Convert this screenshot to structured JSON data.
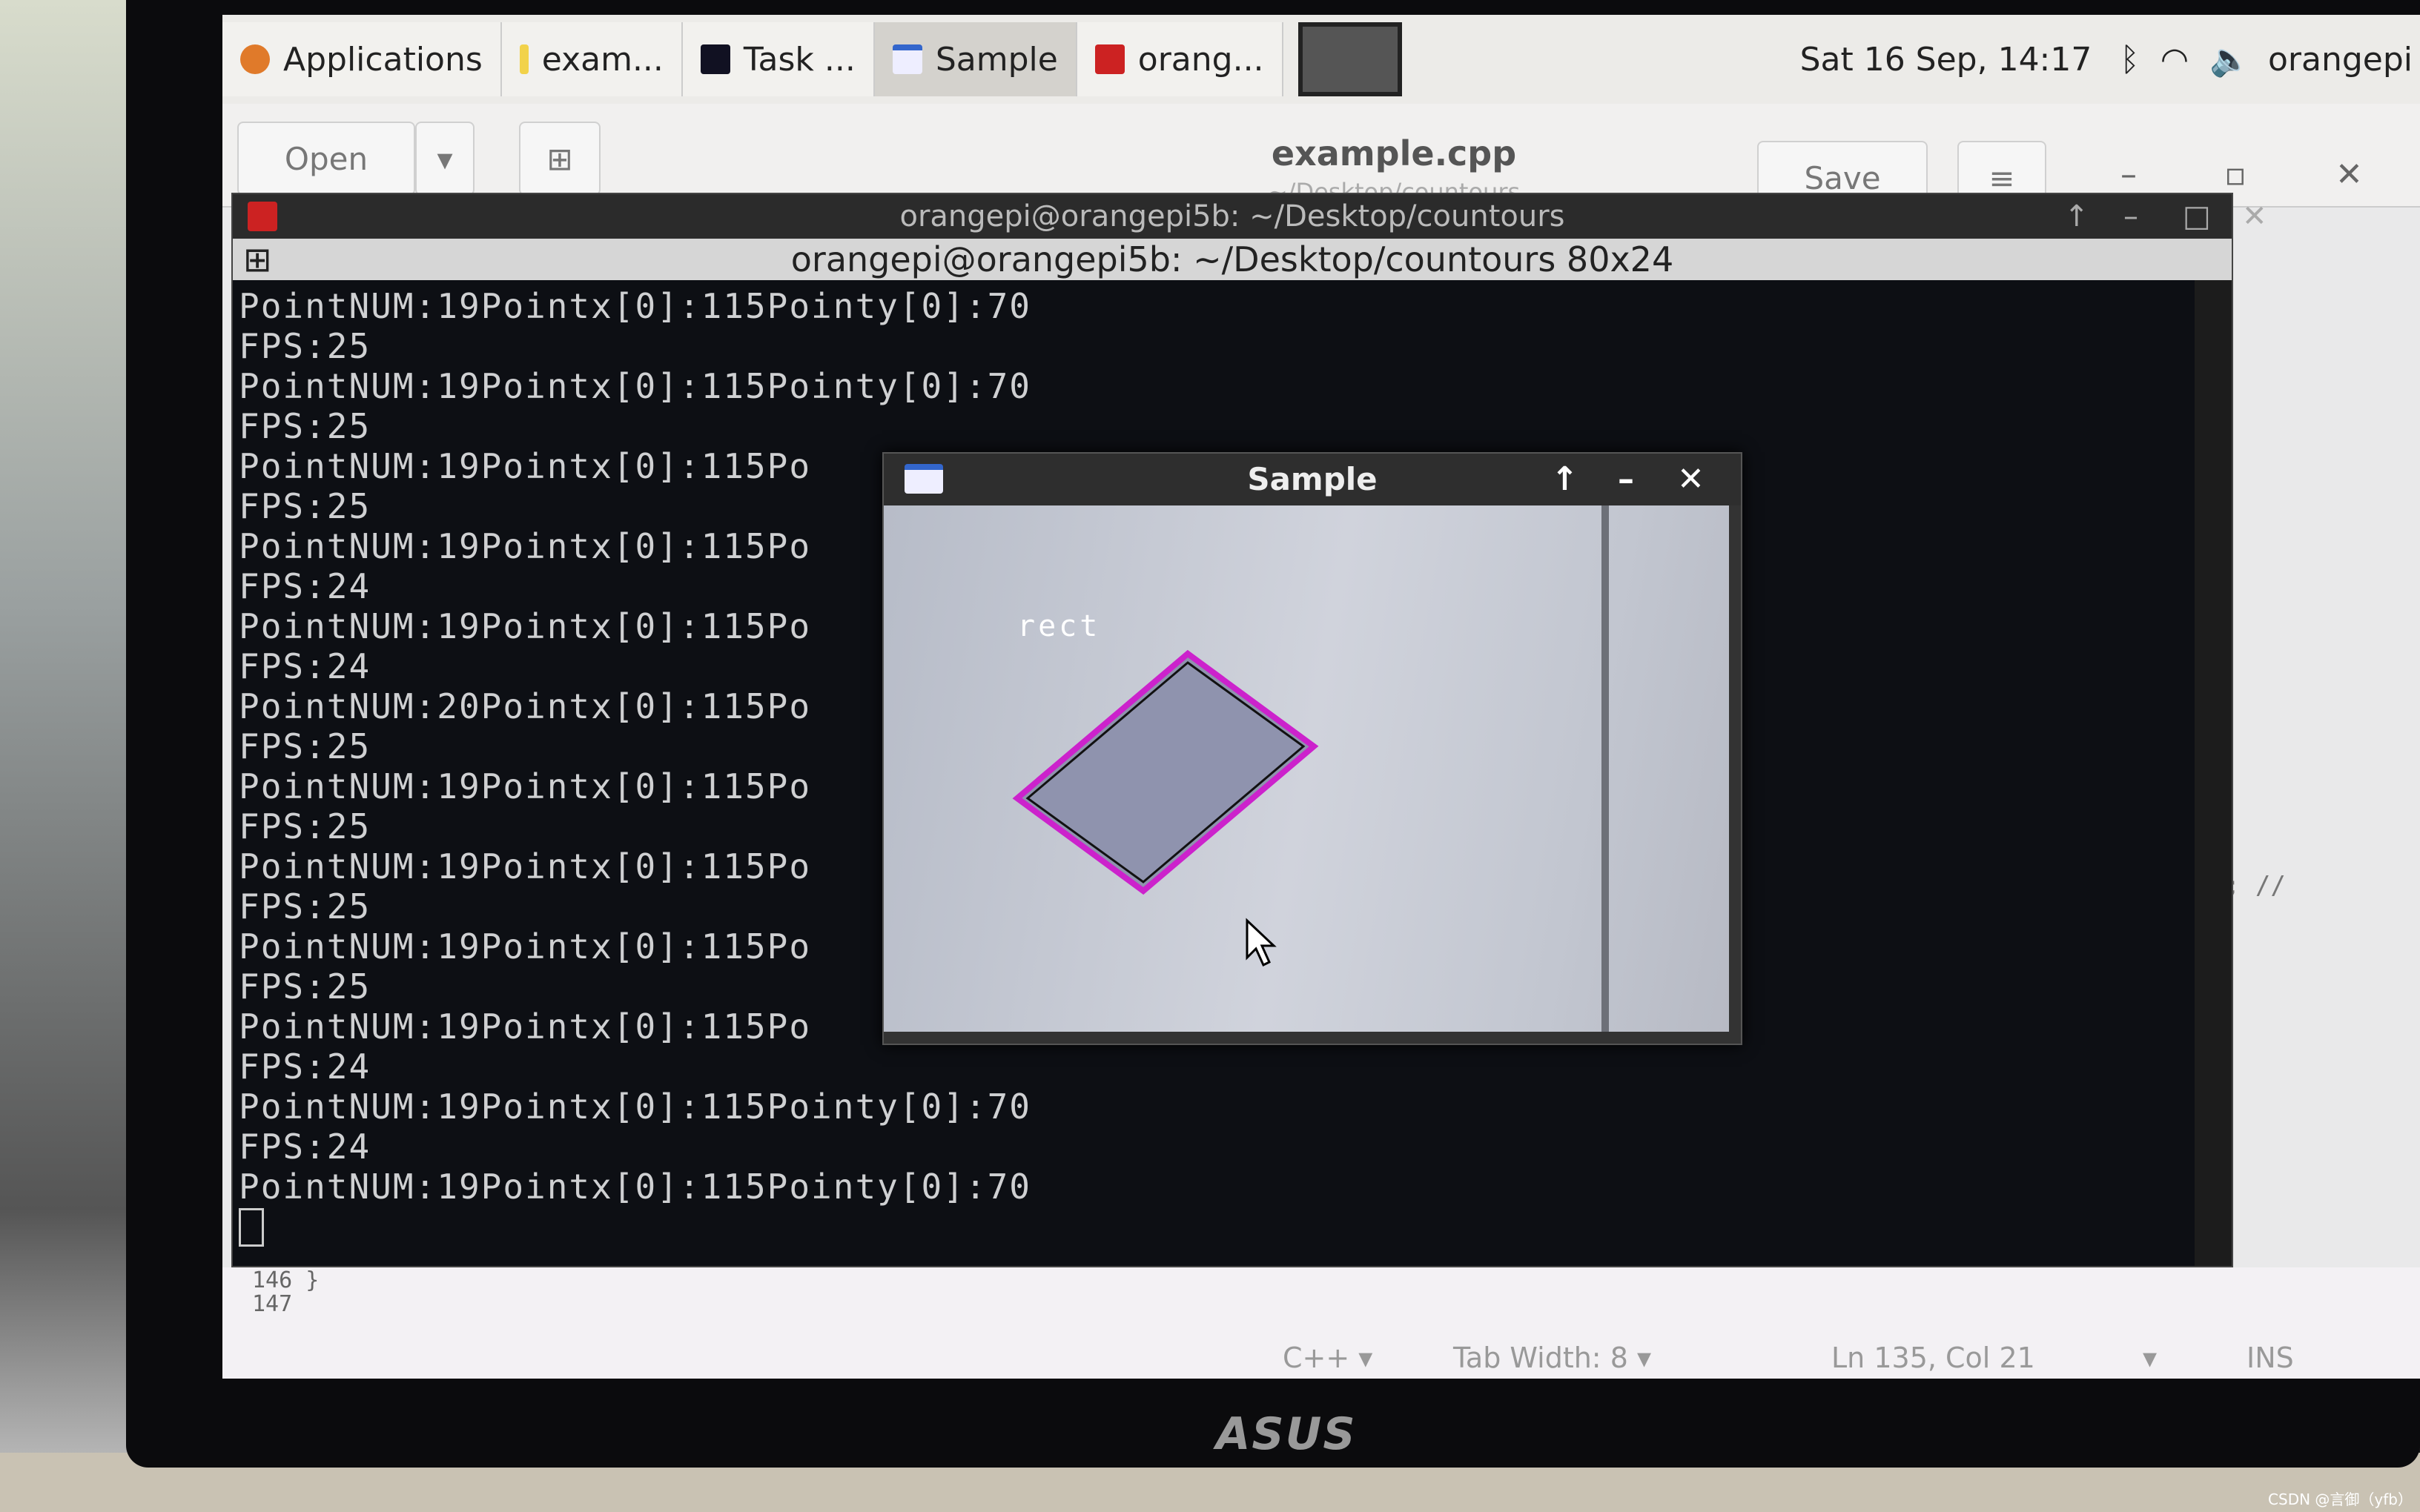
{
  "panel": {
    "applications": "Applications",
    "tasks": [
      {
        "label": "exam...",
        "icon": "text-editor-icon"
      },
      {
        "label": "Task ...",
        "icon": "task-manager-icon"
      },
      {
        "label": "Sample",
        "icon": "window-icon"
      },
      {
        "label": "orang...",
        "icon": "terminal-icon"
      }
    ],
    "clock": "Sat 16 Sep, 14:17",
    "user": "orangepi"
  },
  "gedit": {
    "open": "Open",
    "title": "example.cpp",
    "subtitle": "~/Desktop/countours",
    "save": "Save",
    "line_146": "146 }",
    "line_147": "147",
    "code_fragment": "dl; //",
    "language": "C++",
    "tab_width": "Tab Width: 8",
    "position": "Ln 135, Col 21",
    "mode": "INS"
  },
  "terminal": {
    "title": "orangepi@orangepi5b: ~/Desktop/countours",
    "subtitle": "orangepi@orangepi5b: ~/Desktop/countours 80x24",
    "lines": [
      "PointNUM:19Pointx[0]:115Pointy[0]:70",
      "FPS:25",
      "PointNUM:19Pointx[0]:115Pointy[0]:70",
      "FPS:25",
      "PointNUM:19Pointx[0]:115Po",
      "FPS:25",
      "PointNUM:19Pointx[0]:115Po",
      "FPS:24",
      "PointNUM:19Pointx[0]:115Po",
      "FPS:24",
      "PointNUM:20Pointx[0]:115Po",
      "FPS:25",
      "PointNUM:19Pointx[0]:115Po",
      "FPS:25",
      "PointNUM:19Pointx[0]:115Po",
      "FPS:25",
      "PointNUM:19Pointx[0]:115Po",
      "FPS:25",
      "PointNUM:19Pointx[0]:115Po",
      "FPS:24",
      "PointNUM:19Pointx[0]:115Pointy[0]:70",
      "FPS:24",
      "PointNUM:19Pointx[0]:115Pointy[0]:70"
    ]
  },
  "sample": {
    "title": "Sample",
    "label": "rect",
    "contour_color": "#cc22cc"
  },
  "monitor": {
    "brand": "ASUS"
  },
  "watermark": "CSDN @言御（yfb）"
}
